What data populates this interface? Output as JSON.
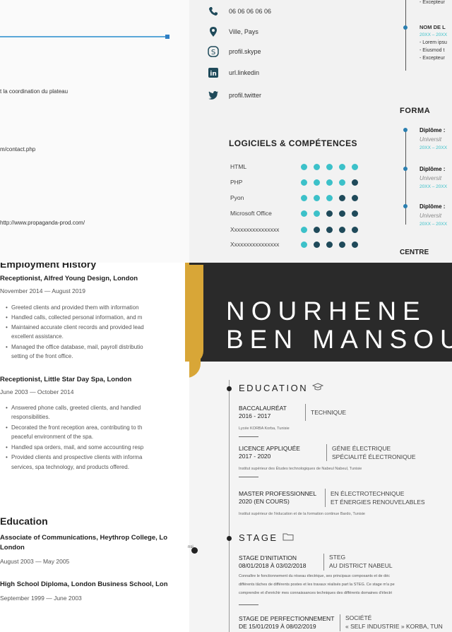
{
  "panel_a": {
    "lines": [
      "t la coordination du plateau",
      "m/contact.php",
      "http://www.propaganda-prod.com/"
    ]
  },
  "panel_b": {
    "contacts": [
      {
        "icon": "phone-icon",
        "text": "06 06 06 06 06"
      },
      {
        "icon": "location-pin-icon",
        "text": "Ville, Pays"
      },
      {
        "icon": "skype-icon",
        "text": "profil.skype"
      },
      {
        "icon": "linkedin-icon",
        "text": "url.linkedin"
      },
      {
        "icon": "twitter-icon",
        "text": "profil.twitter"
      }
    ],
    "skills_title": "LOGICIELS & COMPÉTENCES",
    "skills": [
      {
        "name": "HTML",
        "level": 5
      },
      {
        "name": "PHP",
        "level": 4
      },
      {
        "name": "Pyon",
        "level": 3
      },
      {
        "name": "Microsoft Office",
        "level": 2
      },
      {
        "name": "Xxxxxxxxxxxxxxxx",
        "level": 1
      },
      {
        "name": "Xxxxxxxxxxxxxxxx",
        "level": 1
      }
    ],
    "experience_fragment": {
      "top_line": "- Excepteur",
      "job_title": "NOM DE L",
      "years": "20XX – 20XX",
      "bullets": [
        "- Lorem ipsu",
        "- Eiusmod t",
        "- Excepteur"
      ]
    },
    "formation_title": "FORMA",
    "diplomas": [
      {
        "title": "Diplôme :",
        "school": "Universit",
        "years": "20XX – 20XX"
      },
      {
        "title": "Diplôme :",
        "school": "Universit",
        "years": "20XX – 20XX"
      },
      {
        "title": "Diplôme :",
        "school": "Universit",
        "years": "20XX – 20XX"
      }
    ],
    "centre": "CENTRE"
  },
  "panel_c": {
    "employment_heading": "Employment History",
    "jobs": [
      {
        "title": "Receptionist, Alfred Young Design, London",
        "dates": "November 2014 — August 2019",
        "bullets": [
          "Greeted clients and provided them with information",
          "Handled calls, collected personal information, and m",
          "Maintained accurate client records and provided lead",
          "excellent assistance.",
          "Managed the office database, mail, payroll distributio",
          "setting of the front office."
        ]
      },
      {
        "title": "Receptionist, Little Star Day Spa, London",
        "dates": "June 2003 — October 2014",
        "bullets": [
          "Answered phone calls, greeted clients, and handled",
          "responsibilities.",
          "Decorated the front reception area, contributing to th",
          "peaceful environment of the spa.",
          "Handled spa orders, mail, and some accounting resp",
          "Provided clients and prospective clients with informa",
          "services, spa technology, and products offered."
        ]
      }
    ],
    "education_heading": "Education",
    "education": [
      {
        "title": "Associate of Communications, Heythrop College, Lo",
        "title2": "London",
        "dates": "August 2003 — May 2005"
      },
      {
        "title": "High School Diploma, London Business School, Lon",
        "dates": "September 1999 — June 2003"
      }
    ],
    "side_text": "nsi"
  },
  "panel_d": {
    "first_name": "NOURHENE",
    "last_name": "BEN MANSOU",
    "education_title": "EDUCATION",
    "education": [
      {
        "left1": "BACCALAURÉAT",
        "left2": "2016 - 2017",
        "right1": "TECHNIQUE",
        "right2": "",
        "inst": "Lycée KORBA Korba, Tunisie"
      },
      {
        "left1": "LICENCE APPLIQUÉE",
        "left2": "2017 - 2020",
        "right1": "GÉNIE ÉLECTRIQUE",
        "right2": "SPÉCIALITÉ ÉLECTRONIQUE",
        "inst": "Institut supérieur des Études technologiques de Nabeul Nabeul, Tunisie"
      },
      {
        "left1": "MASTER PROFESSIONNEL",
        "left2": "2020   (EN COURS)",
        "right1": "EN ÉLECTROTECHNIQUE",
        "right2": "ET ÉNERGIES RENOUVELABLES",
        "inst": "Institut supérieur de l'éducation et de la formation continue  Bardo, Tunisie"
      }
    ],
    "stage_title": "STAGE",
    "stages": [
      {
        "left1": "STAGE D'INITIATION",
        "left2": "08/01/2018 À 03/02/2018",
        "right1": "STEG",
        "right2": "AU DISTRICT NABEUL",
        "para": [
          "Connaître le fonctionnement du réseau électrique, ses principaux composants et de déc",
          "différents tâches de différents postes et les travaux réalisés part la STEG. Ce stage m'a pe",
          "comprendre et d'enrichir mes connaissances techniques des différents domaines d'électri"
        ]
      },
      {
        "left1": "STAGE DE PERFECTIONNEMENT",
        "left2": "DE 15/01/2019 À 08/02/2019",
        "right1": "SOCIÉTÉ",
        "right2": "« SELF INDUSTRIE » KORBA, TUN"
      }
    ]
  },
  "colors": {
    "teal": "#3cc1c9",
    "navy": "#1f4a5a",
    "banner": "#2a2a2a",
    "gold": "#d8a637",
    "blue_bar": "#5aa7d8"
  }
}
